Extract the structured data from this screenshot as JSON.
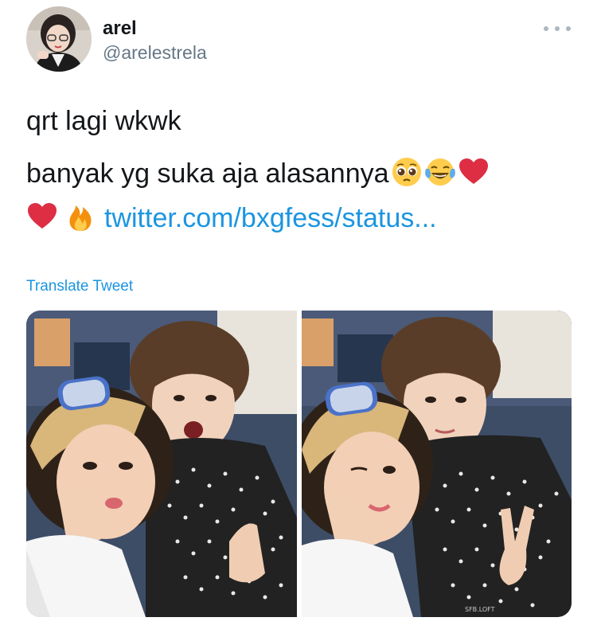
{
  "tweet": {
    "display_name": "arel",
    "handle": "@arelestrela",
    "line1": "qrt lagi wkwk",
    "line2_text": "banyak yg suka aja alasannya",
    "link": "twitter.com/bxgfess/status...",
    "translate_label": "Translate Tweet",
    "more_icon": "more-horizontal-icon"
  },
  "emojis": {
    "line2": [
      "pleading-face-emoji",
      "tears-of-joy-emoji",
      "red-heart-emoji"
    ],
    "line3": [
      "red-heart-emoji",
      "fire-emoji"
    ]
  },
  "media": {
    "photos": [
      {
        "name": "photo-1"
      },
      {
        "name": "photo-2"
      }
    ],
    "watermark": "SFB.LOFT"
  },
  "colors": {
    "link": "#1b95e0",
    "handle": "#657786",
    "text": "#14171a"
  }
}
